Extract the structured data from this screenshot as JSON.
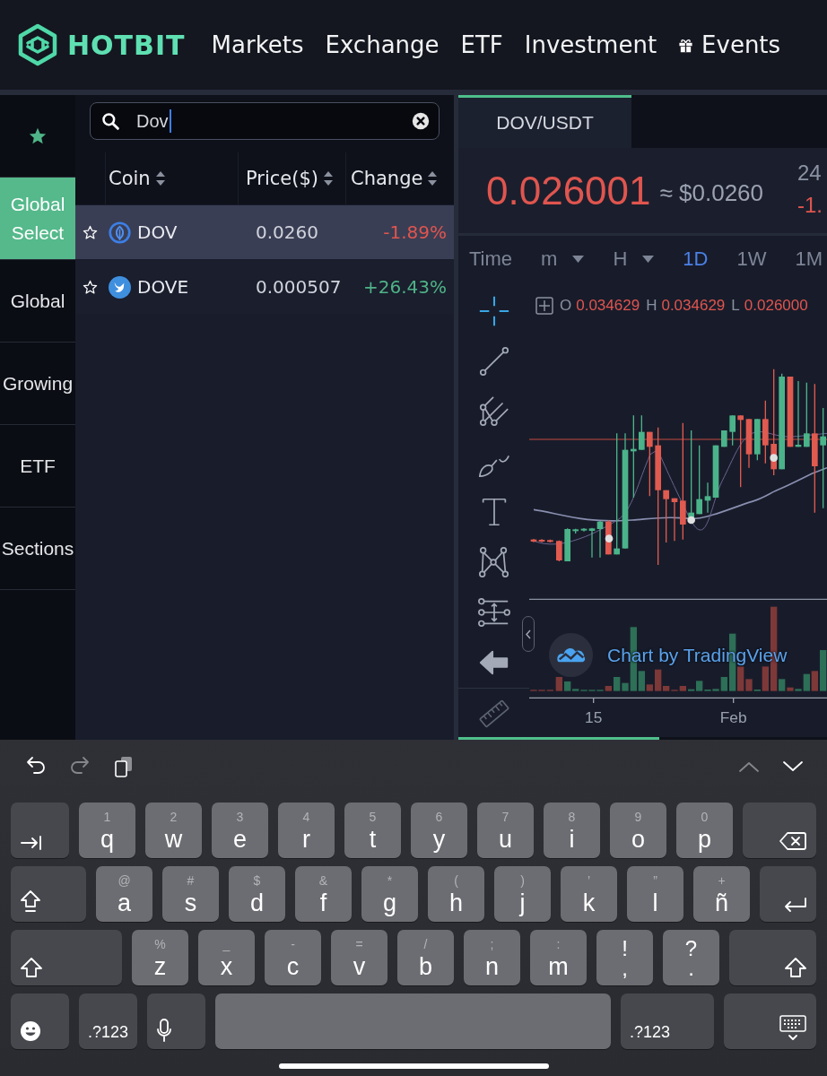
{
  "header": {
    "logo": "HOTBIT",
    "nav": [
      {
        "label": "Markets",
        "kind": "link"
      },
      {
        "label": "Exchange",
        "kind": "link"
      },
      {
        "label": "ETF",
        "kind": "link"
      },
      {
        "label": "Investment",
        "kind": "link"
      },
      {
        "label": "Events",
        "kind": "gift"
      }
    ]
  },
  "sidebar": {
    "items": [
      {
        "kind": "favorites",
        "selected": false
      },
      {
        "kind": "text",
        "label": "Global Select",
        "selected": true
      },
      {
        "kind": "text",
        "label": "Global",
        "selected": false
      },
      {
        "kind": "text",
        "label": "Growing",
        "selected": false
      },
      {
        "kind": "text",
        "label": "ETF",
        "selected": false
      },
      {
        "kind": "text",
        "label": "Sections",
        "selected": false
      }
    ]
  },
  "search": {
    "value": "Dov"
  },
  "table": {
    "columns": [
      "Coin",
      "Price($)",
      "Change"
    ],
    "rows": [
      {
        "favorite": false,
        "kind": "leaf",
        "coin": "DOV",
        "price": "0.0260",
        "change": "-1.89%",
        "rising": false,
        "selected": true
      },
      {
        "favorite": false,
        "kind": "bird",
        "coin": "DOVE",
        "price": "0.000507",
        "change": "+26.43%",
        "rising": true,
        "selected": false
      }
    ]
  },
  "market": {
    "tabs": [
      {
        "label": "DOV/USDT",
        "selected": true
      }
    ],
    "price": "0.026001",
    "rising": false,
    "usd_price": "≈ $0.0260",
    "stat_label": "24",
    "stat_value": "-1.",
    "stat_rising": false
  },
  "timeframes": {
    "label": "Time",
    "options": [
      {
        "label": "m",
        "dropdown": true,
        "selected": false
      },
      {
        "label": "H",
        "dropdown": true,
        "selected": false
      },
      {
        "label": "1D",
        "dropdown": false,
        "selected": true
      },
      {
        "label": "1W",
        "dropdown": false,
        "selected": false
      },
      {
        "label": "1M",
        "dropdown": false,
        "selected": false
      }
    ]
  },
  "chart": {
    "tools": [
      {
        "kind": "crosshair",
        "selected": true
      },
      {
        "kind": "trendline",
        "selected": false
      },
      {
        "kind": "pitchfork",
        "selected": false
      },
      {
        "kind": "brush",
        "selected": false
      },
      {
        "kind": "text",
        "selected": false
      },
      {
        "kind": "pattern",
        "selected": false
      },
      {
        "kind": "measure",
        "selected": false
      },
      {
        "kind": "back",
        "selected": false
      },
      {
        "kind": "ruler",
        "selected": false
      }
    ],
    "legend": [
      {
        "label": "O",
        "value": "0.034629"
      },
      {
        "label": "H",
        "value": "0.034629"
      },
      {
        "label": "L",
        "value": "0.026000"
      }
    ],
    "x_labels": [
      "15",
      "Feb"
    ],
    "attribution": "Chart by TradingView"
  },
  "keyboard": {
    "edit_actions": [
      {
        "kind": "undo",
        "disabled": false
      },
      {
        "kind": "redo",
        "disabled": true
      },
      {
        "kind": "paste",
        "disabled": false
      }
    ],
    "navigation": [
      {
        "kind": "up",
        "disabled": true
      },
      {
        "kind": "down",
        "disabled": false
      }
    ],
    "rows": [
      {
        "keys": [
          {
            "kind": "tab"
          },
          {
            "kind": "letter",
            "label": "q",
            "hint": "1"
          },
          {
            "kind": "letter",
            "label": "w",
            "hint": "2"
          },
          {
            "kind": "letter",
            "label": "e",
            "hint": "3"
          },
          {
            "kind": "letter",
            "label": "r",
            "hint": "4"
          },
          {
            "kind": "letter",
            "label": "t",
            "hint": "5"
          },
          {
            "kind": "letter",
            "label": "y",
            "hint": "6"
          },
          {
            "kind": "letter",
            "label": "u",
            "hint": "7"
          },
          {
            "kind": "letter",
            "label": "i",
            "hint": "8"
          },
          {
            "kind": "letter",
            "label": "o",
            "hint": "9"
          },
          {
            "kind": "letter",
            "label": "p",
            "hint": "0"
          },
          {
            "kind": "delete"
          }
        ]
      },
      {
        "keys": [
          {
            "kind": "capslock"
          },
          {
            "kind": "letter",
            "label": "a",
            "hint": "@"
          },
          {
            "kind": "letter",
            "label": "s",
            "hint": "#"
          },
          {
            "kind": "letter",
            "label": "d",
            "hint": "$"
          },
          {
            "kind": "letter",
            "label": "f",
            "hint": "&"
          },
          {
            "kind": "letter",
            "label": "g",
            "hint": "*"
          },
          {
            "kind": "letter",
            "label": "h",
            "hint": "("
          },
          {
            "kind": "letter",
            "label": "j",
            "hint": ")"
          },
          {
            "kind": "letter",
            "label": "k",
            "hint": "’"
          },
          {
            "kind": "letter",
            "label": "l",
            "hint": "”"
          },
          {
            "kind": "letter",
            "label": "ñ",
            "hint": "+"
          },
          {
            "kind": "return"
          }
        ]
      },
      {
        "keys": [
          {
            "kind": "shift"
          },
          {
            "kind": "letter",
            "label": "z",
            "hint": "%"
          },
          {
            "kind": "letter",
            "label": "x",
            "hint": "_"
          },
          {
            "kind": "letter",
            "label": "c",
            "hint": "-"
          },
          {
            "kind": "letter",
            "label": "v",
            "hint": "="
          },
          {
            "kind": "letter",
            "label": "b",
            "hint": "/"
          },
          {
            "kind": "letter",
            "label": "n",
            "hint": ";"
          },
          {
            "kind": "letter",
            "label": "m",
            "hint": ":"
          },
          {
            "kind": "symbol",
            "label": ",",
            "hint": "!"
          },
          {
            "kind": "symbol",
            "label": ".",
            "hint": "?"
          },
          {
            "kind": "shift"
          }
        ]
      },
      {
        "keys": [
          {
            "kind": "emoji"
          },
          {
            "kind": "numbers",
            "label": ".?123"
          },
          {
            "kind": "mic"
          },
          {
            "kind": "space"
          },
          {
            "kind": "numbers",
            "label": ".?123"
          },
          {
            "kind": "hide"
          }
        ]
      }
    ]
  }
}
